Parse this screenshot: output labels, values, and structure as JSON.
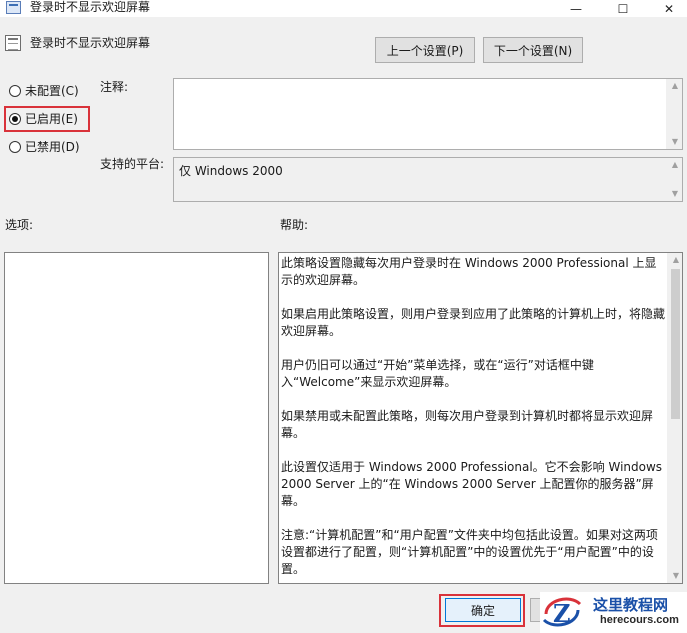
{
  "window": {
    "title": "登录时不显示欢迎屏幕",
    "controls": {
      "minimize": "—",
      "maximize": "☐",
      "close": "✕"
    }
  },
  "header": {
    "policy_title": "登录时不显示欢迎屏幕",
    "icon": "policy-setting-icon",
    "prev_button": "上一个设置(P)",
    "next_button": "下一个设置(N)"
  },
  "state": {
    "options": [
      {
        "label": "未配置(C)",
        "selected": false
      },
      {
        "label": "已启用(E)",
        "selected": true
      },
      {
        "label": "已禁用(D)",
        "selected": false
      }
    ]
  },
  "fields": {
    "comment_label": "注释:",
    "comment_value": "",
    "platform_label": "支持的平台:",
    "platform_value": "仅 Windows 2000"
  },
  "panels": {
    "options_label": "选项:",
    "help_label": "帮助:",
    "help_paragraphs": [
      "此策略设置隐藏每次用户登录时在 Windows 2000 Professional 上显示的欢迎屏幕。",
      "如果启用此策略设置，则用户登录到应用了此策略的计算机上时，将隐藏欢迎屏幕。",
      "用户仍旧可以通过“开始”菜单选择，或在“运行”对话框中键入“Welcome”来显示欢迎屏幕。",
      "如果禁用或未配置此策略，则每次用户登录到计算机时都将显示欢迎屏幕。",
      "此设置仅适用于 Windows 2000 Professional。它不会影响 Windows 2000 Server 上的“在 Windows 2000 Server 上配置你的服务器”屏幕。",
      "注意:“计算机配置”和“用户配置”文件夹中均包括此设置。如果对这两项设置都进行了配置，则“计算机配置”中的设置优先于“用户配置”中的设置。"
    ]
  },
  "footer": {
    "ok_button": "确定"
  },
  "watermark": {
    "name": "这里教程网",
    "domain": "herecours.com",
    "logo_letter": "Z"
  },
  "colors": {
    "highlight": "#d9323a",
    "ok_border": "#0078d7",
    "watermark_blue": "#1a50a8"
  }
}
